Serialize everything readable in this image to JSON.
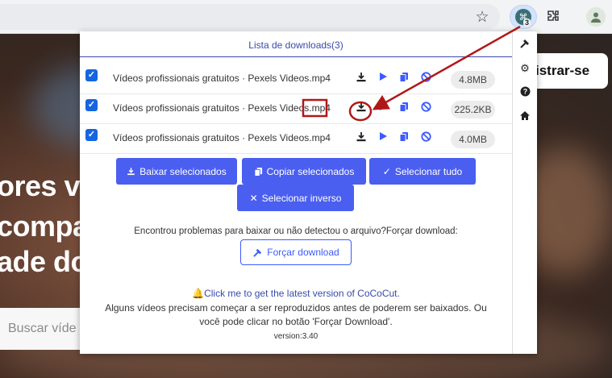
{
  "browser": {
    "extension_badge": "3",
    "icons": [
      "star-icon",
      "extension-icon",
      "puzzle-icon",
      "profile-icon"
    ]
  },
  "background_page": {
    "hero_lines": [
      "ores víd",
      "compa",
      "ade do"
    ],
    "search_placeholder": "Buscar víde",
    "signup_label": "istrar-se"
  },
  "popup": {
    "title": "Lista de downloads(3)",
    "rows": [
      {
        "name": "Vídeos profissionais gratuitos · Pexels Videos.mp4",
        "size": "4.8MB",
        "checked": true
      },
      {
        "name": "Vídeos profissionais gratuitos · Pexels Videos.mp4",
        "size": "225.2KB",
        "checked": true
      },
      {
        "name": "Vídeos profissionais gratuitos · Pexels Videos.mp4",
        "size": "4.0MB",
        "checked": true
      }
    ],
    "buttons": {
      "download_selected": "Baixar selecionados",
      "copy_selected": "Copiar selecionados",
      "select_all": "Selecionar tudo",
      "select_inverse": "Selecionar inverso"
    },
    "problem_text": "Encontrou problemas para baixar ou não detectou o arquivo?Forçar download:",
    "force_download": "Forçar download",
    "latest_link": "Click me to get the latest version of CoCoCut.",
    "notice": "Alguns vídeos precisam começar a ser reproduzidos antes de poderem ser baixados. Ou você pode clicar no botão 'Forçar Download'.",
    "version": "version:3.40"
  },
  "colors": {
    "accent": "#4a5ff0",
    "annotation": "#b01818"
  }
}
